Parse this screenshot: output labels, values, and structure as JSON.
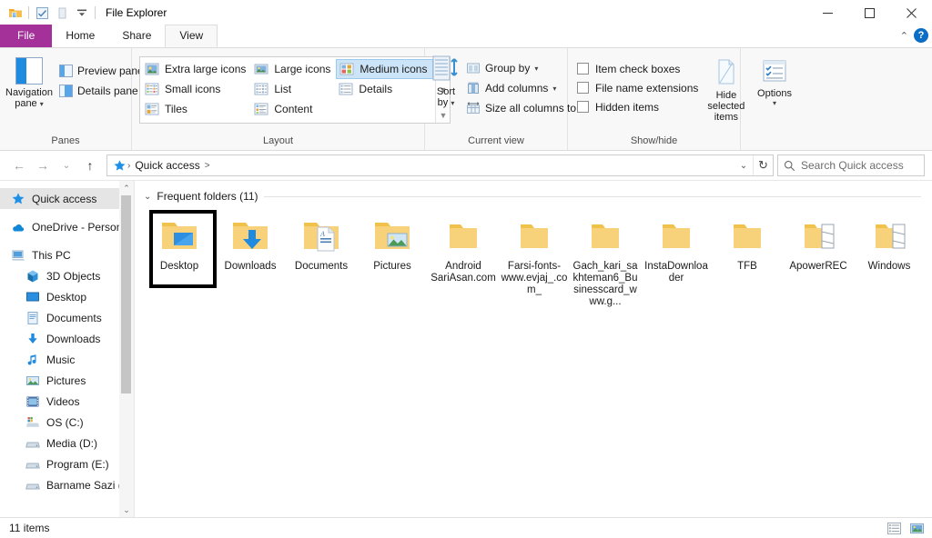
{
  "window": {
    "title": "File Explorer",
    "quick_access_toolbar": [
      {
        "name": "explorer-icon",
        "label": "File Explorer"
      },
      {
        "name": "properties-icon",
        "label": "Properties"
      },
      {
        "name": "new-folder-icon",
        "label": "New folder"
      },
      {
        "name": "customize-dropdown-icon",
        "label": "Customize Quick Access Toolbar"
      }
    ],
    "controls": {
      "minimize": "Minimize",
      "maximize": "Maximize",
      "close": "Close"
    }
  },
  "tabs": [
    {
      "label": "File",
      "active": false,
      "style": "file"
    },
    {
      "label": "Home",
      "active": false
    },
    {
      "label": "Share",
      "active": false
    },
    {
      "label": "View",
      "active": true
    }
  ],
  "ribbon_right": {
    "collapse_label": "Minimize the Ribbon",
    "help_label": "?"
  },
  "ribbon": {
    "groups": [
      {
        "name": "panes",
        "label": "Panes",
        "big_button": {
          "label_line1": "Navigation",
          "label_line2": "pane",
          "has_caret": true
        },
        "small_buttons": [
          {
            "label": "Preview pane",
            "icon": "preview-pane-icon"
          },
          {
            "label": "Details pane",
            "icon": "details-pane-icon"
          }
        ]
      },
      {
        "name": "layout",
        "label": "Layout",
        "items": [
          {
            "label": "Extra large icons",
            "icon": "extra-large-icons-icon",
            "selected": false
          },
          {
            "label": "Small icons",
            "icon": "small-icons-icon",
            "selected": false
          },
          {
            "label": "Tiles",
            "icon": "tiles-icon",
            "selected": false
          },
          {
            "label": "Large icons",
            "icon": "large-icons-icon",
            "selected": false
          },
          {
            "label": "List",
            "icon": "list-icon",
            "selected": false
          },
          {
            "label": "Content",
            "icon": "content-icon",
            "selected": false
          },
          {
            "label": "Medium icons",
            "icon": "medium-icons-icon",
            "selected": true
          },
          {
            "label": "Details",
            "icon": "details-icon",
            "selected": false
          }
        ],
        "scroll": {
          "up": "▲",
          "down": "▼",
          "more": "More"
        }
      },
      {
        "name": "current-view",
        "label": "Current view",
        "big_button": {
          "label_line1": "Sort",
          "label_line2": "by",
          "has_caret": true
        },
        "small_buttons": [
          {
            "label": "Group by",
            "icon": "group-by-icon",
            "has_caret": true
          },
          {
            "label": "Add columns",
            "icon": "add-columns-icon",
            "has_caret": true
          },
          {
            "label": "Size all columns to fit",
            "icon": "size-columns-icon",
            "has_caret": false
          }
        ]
      },
      {
        "name": "show-hide",
        "label": "Show/hide",
        "checkboxes": [
          {
            "label": "Item check boxes",
            "checked": false
          },
          {
            "label": "File name extensions",
            "checked": false
          },
          {
            "label": "Hidden items",
            "checked": false
          }
        ],
        "big_button": {
          "label_line1": "Hide selected",
          "label_line2": "items"
        }
      },
      {
        "name": "options",
        "label": "",
        "big_button": {
          "label_line1": "Options",
          "label_line2": "",
          "has_caret": true
        }
      }
    ]
  },
  "navbar": {
    "back": "Back",
    "forward": "Forward",
    "recent": "Recent locations",
    "up": "Up",
    "breadcrumb": {
      "icon": "quick-access-star-icon",
      "items": [
        "Quick access"
      ],
      "trailing_sep": ">"
    },
    "dropdown": "Previous locations",
    "refresh": "Refresh",
    "search": {
      "placeholder": "Search Quick access",
      "icon": "search-icon"
    }
  },
  "sidebar": {
    "items": [
      {
        "label": "Quick access",
        "icon": "star-icon",
        "indent": false,
        "selected": true
      },
      {
        "label": "OneDrive - Person",
        "icon": "onedrive-cloud-icon",
        "indent": false,
        "selected": false,
        "gap_before": true
      },
      {
        "label": "This PC",
        "icon": "this-pc-icon",
        "indent": false,
        "selected": false,
        "gap_before": true
      },
      {
        "label": "3D Objects",
        "icon": "3d-objects-icon",
        "indent": true,
        "selected": false
      },
      {
        "label": "Desktop",
        "icon": "desktop-icon",
        "indent": true,
        "selected": false
      },
      {
        "label": "Documents",
        "icon": "documents-icon",
        "indent": true,
        "selected": false
      },
      {
        "label": "Downloads",
        "icon": "downloads-icon",
        "indent": true,
        "selected": false
      },
      {
        "label": "Music",
        "icon": "music-icon",
        "indent": true,
        "selected": false
      },
      {
        "label": "Pictures",
        "icon": "pictures-icon",
        "indent": true,
        "selected": false
      },
      {
        "label": "Videos",
        "icon": "videos-icon",
        "indent": true,
        "selected": false
      },
      {
        "label": "OS (C:)",
        "icon": "os-drive-icon",
        "indent": true,
        "selected": false
      },
      {
        "label": "Media (D:)",
        "icon": "drive-icon",
        "indent": true,
        "selected": false
      },
      {
        "label": "Program (E:)",
        "icon": "drive-icon",
        "indent": true,
        "selected": false
      },
      {
        "label": "Barname Sazi (F:",
        "icon": "drive-icon",
        "indent": true,
        "selected": false
      }
    ],
    "scrollbar": {
      "up": "⌃",
      "down": "⌄"
    }
  },
  "content": {
    "group": {
      "chevron": "⌄",
      "title": "Frequent folders (11)"
    },
    "folders": [
      {
        "label": "Desktop",
        "icon": "folder-desktop-icon",
        "highlighted": true
      },
      {
        "label": "Downloads",
        "icon": "folder-downloads-icon",
        "highlighted": false
      },
      {
        "label": "Documents",
        "icon": "folder-documents-icon",
        "highlighted": false
      },
      {
        "label": "Pictures",
        "icon": "folder-pictures-icon",
        "highlighted": false
      },
      {
        "label": "Android SariAsan.com",
        "icon": "folder-icon",
        "highlighted": false
      },
      {
        "label": "Farsi-fonts-www.evjaj_.com_",
        "icon": "folder-icon",
        "highlighted": false
      },
      {
        "label": "Gach_kari_sakhteman6_Businesscard_www.g...",
        "icon": "folder-icon",
        "highlighted": false
      },
      {
        "label": "InstaDownloader",
        "icon": "folder-icon",
        "highlighted": false
      },
      {
        "label": "TFB",
        "icon": "folder-icon",
        "highlighted": false
      },
      {
        "label": "ApowerREC",
        "icon": "folder-open-icon",
        "highlighted": false
      },
      {
        "label": "Windows",
        "icon": "folder-open-icon",
        "highlighted": false
      }
    ]
  },
  "statusbar": {
    "item_count": "11 items",
    "view_buttons": [
      {
        "name": "details-view-button",
        "label": "Details view"
      },
      {
        "name": "large-icons-view-button",
        "label": "Large icons view"
      }
    ]
  },
  "colors": {
    "file_tab": "#A4309A",
    "accent_blue": "#0b6ec4",
    "folder_yellow": "#f5cf70",
    "selection_highlight": "#000000",
    "gallery_selected": "#cce4f7"
  }
}
